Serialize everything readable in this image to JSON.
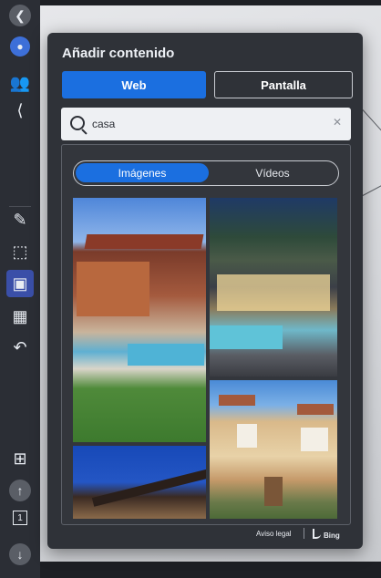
{
  "panel": {
    "title": "Añadir contenido",
    "tabs": [
      {
        "label": "Web",
        "selected": true
      },
      {
        "label": "Pantalla",
        "selected": false
      }
    ]
  },
  "search": {
    "value": "casa",
    "clear_icon": "close-icon"
  },
  "results": {
    "types": [
      {
        "label": "Imágenes",
        "selected": true
      },
      {
        "label": "Vídeos",
        "selected": false
      }
    ]
  },
  "footer": {
    "legal": "Aviso legal",
    "provider": "Bing"
  },
  "colors": {
    "accent": "#1b6fe0",
    "panel": "#2f3238",
    "toolbar": "#2b2e35"
  },
  "toolbar": {
    "icons": [
      "back-arrow-icon",
      "brand-logo-icon",
      "participants-icon",
      "share-icon",
      "pen-icon",
      "selection-icon",
      "add-content-icon",
      "layout-icon",
      "undo-icon",
      "add-page-icon",
      "up-arrow-icon",
      "page-number-icon",
      "down-arrow-icon"
    ],
    "page_number": "1"
  }
}
